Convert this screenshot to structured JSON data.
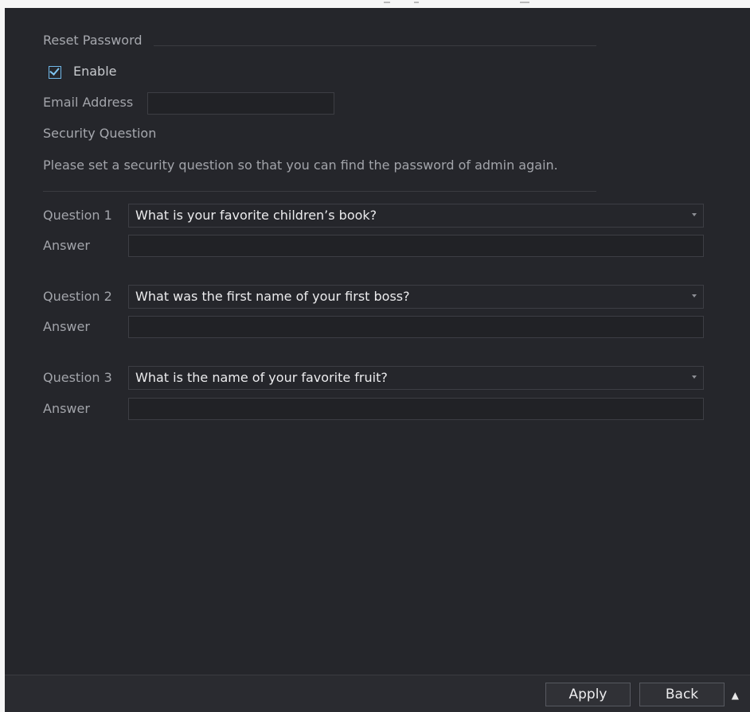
{
  "reset_password": {
    "title": "Reset Password",
    "enable_label": "Enable",
    "enable_checked": true,
    "email_label": "Email Address",
    "email_value": ""
  },
  "security_question": {
    "title": "Security Question",
    "instruction": "Please set a security question so that you can find the password of admin again.",
    "questions": [
      {
        "label": "Question 1",
        "selected": "What is your favorite children’s book?",
        "answer_label": "Answer",
        "answer_value": ""
      },
      {
        "label": "Question 2",
        "selected": "What was the first name of your first boss?",
        "answer_label": "Answer",
        "answer_value": ""
      },
      {
        "label": "Question 3",
        "selected": "What is the name of your favorite fruit?",
        "answer_label": "Answer",
        "answer_value": ""
      }
    ]
  },
  "footer": {
    "apply_label": "Apply",
    "back_label": "Back"
  },
  "colors": {
    "background": "#25262b",
    "text": "#a2a4aa",
    "value_text": "#ececee",
    "checkbox_accent": "#6fb7e8"
  },
  "icons": {
    "enable_checkbox": "checkmark-icon",
    "dropdown_caret": "caret-down-icon",
    "pointer": "mouse-pointer-icon"
  }
}
